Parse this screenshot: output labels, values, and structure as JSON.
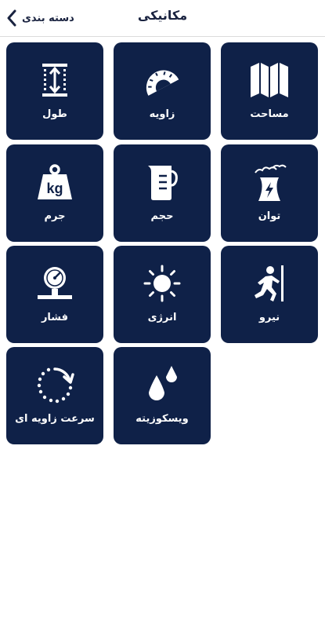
{
  "header": {
    "title": "مکانیکی",
    "back_label": "دسته بندی"
  },
  "tiles": [
    {
      "label": "مساحت",
      "icon": "map-icon"
    },
    {
      "label": "زاویه",
      "icon": "protractor-icon"
    },
    {
      "label": "طول",
      "icon": "length-icon"
    },
    {
      "label": "توان",
      "icon": "power-plant-icon"
    },
    {
      "label": "حجم",
      "icon": "measuring-cup-icon"
    },
    {
      "label": "جرم",
      "icon": "weight-kg-icon"
    },
    {
      "label": "نیرو",
      "icon": "push-force-icon"
    },
    {
      "label": "انرژی",
      "icon": "sun-icon"
    },
    {
      "label": "فشار",
      "icon": "pressure-gauge-icon"
    },
    {
      "label": "ویسکوزیته",
      "icon": "drops-icon"
    },
    {
      "label": "سرعت زاویه ای",
      "icon": "rotation-icon"
    }
  ],
  "weight_icon_text": "kg",
  "colors": {
    "tile_background": "#0f2148",
    "tile_text": "#ffffff",
    "header_text": "#1a2340"
  }
}
